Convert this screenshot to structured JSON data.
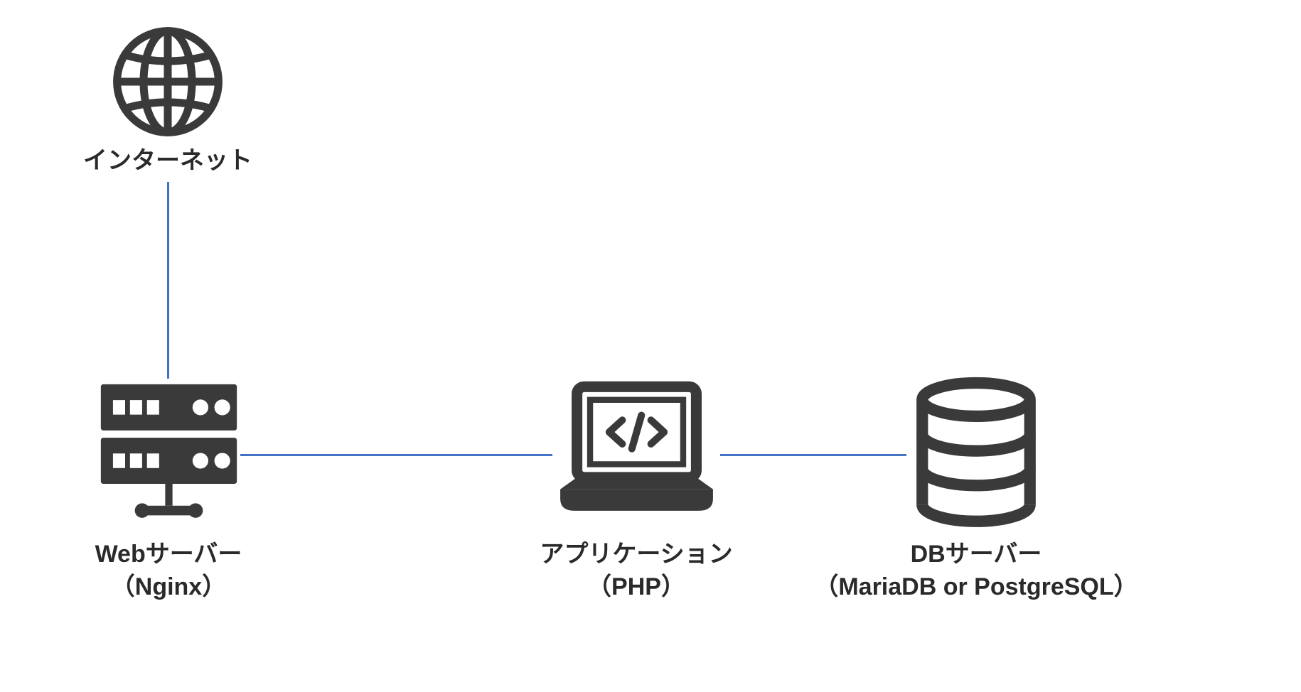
{
  "nodes": {
    "internet": {
      "label_main": "インターネット",
      "label_sub": "",
      "icon": "globe-icon"
    },
    "web_server": {
      "label_main": "Webサーバー",
      "label_sub": "（Nginx）",
      "icon": "server-icon"
    },
    "application": {
      "label_main": "アプリケーション",
      "label_sub": "（PHP）",
      "icon": "laptop-code-icon"
    },
    "db_server": {
      "label_main": "DBサーバー",
      "label_sub": "（MariaDB or PostgreSQL）",
      "icon": "database-icon"
    }
  },
  "colors": {
    "icon": "#3a3a3a",
    "text": "#2a2a2a",
    "connector": "#4472c4"
  }
}
